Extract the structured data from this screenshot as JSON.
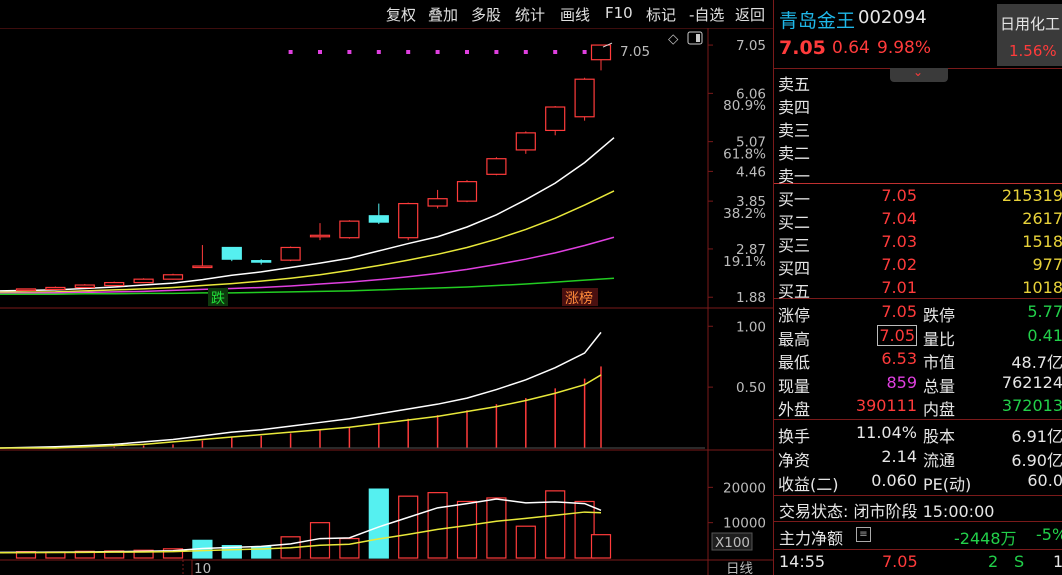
{
  "toolbar": {
    "items": [
      "复权",
      "叠加",
      "多股",
      "统计",
      "画线",
      "F10",
      "标记",
      "-自选",
      "返回"
    ]
  },
  "header": {
    "stock_name": "青岛金王",
    "stock_code": "002094",
    "price": "7.05",
    "change": "0.64",
    "change_pct": "9.98%",
    "sector_name": "日用化工",
    "sector_pct": "1.56%"
  },
  "orderbook": {
    "sell": [
      {
        "label": "卖五",
        "price": "",
        "vol": ""
      },
      {
        "label": "卖四",
        "price": "",
        "vol": ""
      },
      {
        "label": "卖三",
        "price": "",
        "vol": ""
      },
      {
        "label": "卖二",
        "price": "",
        "vol": ""
      },
      {
        "label": "卖一",
        "price": "",
        "vol": ""
      }
    ],
    "buy": [
      {
        "label": "买一",
        "price": "7.05",
        "vol": "215319"
      },
      {
        "label": "买二",
        "price": "7.04",
        "vol": "2617"
      },
      {
        "label": "买三",
        "price": "7.03",
        "vol": "1518"
      },
      {
        "label": "买四",
        "price": "7.02",
        "vol": "977"
      },
      {
        "label": "买五",
        "price": "7.01",
        "vol": "1018"
      }
    ]
  },
  "stats": [
    {
      "l1": "涨停",
      "v1": "7.05",
      "l2": "跌停",
      "v2": "5.77",
      "c1": "red",
      "c2": "green"
    },
    {
      "l1": "最高",
      "v1": "7.05",
      "l2": "量比",
      "v2": "0.41",
      "c1": "red",
      "c2": "green"
    },
    {
      "l1": "最低",
      "v1": "6.53",
      "l2": "市值",
      "v2": "48.7亿",
      "c1": "red",
      "c2": "white"
    },
    {
      "l1": "现量",
      "v1": "859",
      "l2": "总量",
      "v2": "762124",
      "c1": "magenta",
      "c2": "white"
    },
    {
      "l1": "外盘",
      "v1": "390111",
      "l2": "内盘",
      "v2": "372013",
      "c1": "red",
      "c2": "green"
    }
  ],
  "stats2": [
    {
      "l1": "换手",
      "v1": "11.04%",
      "l2": "股本",
      "v2": "6.91亿",
      "c1": "white",
      "c2": "white"
    },
    {
      "l1": "净资",
      "v1": "2.14",
      "l2": "流通",
      "v2": "6.90亿",
      "c1": "white",
      "c2": "white"
    },
    {
      "l1": "收益(二)",
      "v1": "0.060",
      "l2": "PE(动)",
      "v2": "60.0",
      "c1": "white",
      "c2": "white"
    }
  ],
  "trade_status": "交易状态: 闭市阶段 15:00:00",
  "main_flow": {
    "label": "主力净额",
    "value": "-2448万",
    "pct": "-5%"
  },
  "tick": {
    "time": "14:55",
    "price": "7.05",
    "vol": "2",
    "side": "S",
    "extra": "1"
  },
  "chart_labels": {
    "price_marker": "7.05",
    "signal_down": "跌",
    "signal_limit": "涨榜",
    "date_tick": "10",
    "period": "日线",
    "vol_unit": "X100"
  },
  "colors": {
    "up": "#ff3b3b",
    "down": "#55f0f0",
    "ma1": "#ffffff",
    "ma2": "#e8e83a",
    "ma3": "#e040e0",
    "ma4": "#22cc22"
  },
  "chart_data": [
    {
      "type": "candlestick",
      "y_axis_ticks": [
        "7.05",
        "6.06",
        "5.07",
        "4.46",
        "3.85",
        "2.87",
        "1.88"
      ],
      "pct_axis_ticks": [
        "80.9%",
        "61.8%",
        "38.2%",
        "19.1%"
      ],
      "ylim": [
        1.7,
        7.4
      ],
      "candles": [
        {
          "o": 2.03,
          "c": 2.05,
          "h": 2.06,
          "l": 2.02
        },
        {
          "o": 2.04,
          "c": 2.08,
          "h": 2.1,
          "l": 2.03
        },
        {
          "o": 2.08,
          "c": 2.13,
          "h": 2.15,
          "l": 2.07
        },
        {
          "o": 2.12,
          "c": 2.18,
          "h": 2.2,
          "l": 2.11
        },
        {
          "o": 2.18,
          "c": 2.25,
          "h": 2.27,
          "l": 2.17
        },
        {
          "o": 2.25,
          "c": 2.34,
          "h": 2.36,
          "l": 2.24
        },
        {
          "o": 2.52,
          "c": 2.52,
          "h": 2.95,
          "l": 2.5
        },
        {
          "o": 2.9,
          "c": 2.66,
          "h": 2.9,
          "l": 2.62
        },
        {
          "o": 2.63,
          "c": 2.6,
          "h": 2.66,
          "l": 2.55
        },
        {
          "o": 2.64,
          "c": 2.9,
          "h": 2.92,
          "l": 2.62
        },
        {
          "o": 3.15,
          "c": 3.15,
          "h": 3.4,
          "l": 3.05
        },
        {
          "o": 3.1,
          "c": 3.44,
          "h": 3.46,
          "l": 3.08
        },
        {
          "o": 3.55,
          "c": 3.42,
          "h": 3.8,
          "l": 3.38
        },
        {
          "o": 3.1,
          "c": 3.8,
          "h": 3.82,
          "l": 3.05
        },
        {
          "o": 3.75,
          "c": 3.9,
          "h": 4.08,
          "l": 3.7
        },
        {
          "o": 3.85,
          "c": 4.25,
          "h": 4.28,
          "l": 3.83
        },
        {
          "o": 4.4,
          "c": 4.72,
          "h": 4.75,
          "l": 4.38
        },
        {
          "o": 4.9,
          "c": 5.25,
          "h": 5.28,
          "l": 4.82
        },
        {
          "o": 5.3,
          "c": 5.78,
          "h": 5.8,
          "l": 5.2
        },
        {
          "o": 5.58,
          "c": 6.35,
          "h": 6.38,
          "l": 5.5
        },
        {
          "o": 6.75,
          "c": 7.05,
          "h": 7.05,
          "l": 6.53
        }
      ],
      "ma": [
        {
          "name": "MA5",
          "values": [
            2.01,
            2.03,
            2.06,
            2.09,
            2.13,
            2.17,
            2.24,
            2.33,
            2.4,
            2.49,
            2.58,
            2.68,
            2.83,
            2.98,
            3.12,
            3.32,
            3.57,
            3.88,
            4.22,
            4.64,
            5.15
          ]
        },
        {
          "name": "MA10",
          "values": [
            1.98,
            1.99,
            2.01,
            2.03,
            2.05,
            2.08,
            2.12,
            2.16,
            2.21,
            2.27,
            2.34,
            2.43,
            2.53,
            2.64,
            2.76,
            2.9,
            3.07,
            3.27,
            3.5,
            3.77,
            4.06
          ]
        },
        {
          "name": "MA20",
          "values": [
            1.96,
            1.97,
            1.98,
            1.99,
            2.0,
            2.02,
            2.04,
            2.06,
            2.08,
            2.11,
            2.15,
            2.19,
            2.24,
            2.3,
            2.37,
            2.45,
            2.55,
            2.66,
            2.79,
            2.94,
            3.11
          ]
        },
        {
          "name": "MA60",
          "values": [
            1.94,
            1.94,
            1.95,
            1.95,
            1.96,
            1.96,
            1.97,
            1.97,
            1.98,
            1.99,
            2.0,
            2.01,
            2.03,
            2.05,
            2.07,
            2.09,
            2.12,
            2.15,
            2.19,
            2.23,
            2.27
          ]
        }
      ]
    },
    {
      "type": "bar",
      "y_axis_ticks": [
        "1.00",
        "0.50"
      ],
      "ylim": [
        0,
        1.15
      ],
      "values": [
        0.0,
        0.0,
        0.0,
        0.01,
        0.02,
        0.03,
        0.06,
        0.09,
        0.1,
        0.12,
        0.15,
        0.17,
        0.2,
        0.24,
        0.27,
        0.31,
        0.36,
        0.41,
        0.49,
        0.57,
        0.67
      ],
      "series": [
        {
          "name": "line1",
          "values": [
            0.0,
            0.01,
            0.02,
            0.03,
            0.05,
            0.07,
            0.1,
            0.13,
            0.15,
            0.18,
            0.21,
            0.24,
            0.28,
            0.32,
            0.36,
            0.41,
            0.48,
            0.56,
            0.66,
            0.78,
            0.95
          ]
        },
        {
          "name": "line2",
          "values": [
            0.0,
            0.0,
            0.01,
            0.02,
            0.03,
            0.05,
            0.07,
            0.09,
            0.11,
            0.13,
            0.15,
            0.17,
            0.2,
            0.23,
            0.26,
            0.3,
            0.34,
            0.39,
            0.45,
            0.52,
            0.6
          ]
        }
      ]
    },
    {
      "type": "bar",
      "y_axis_ticks": [
        "20000",
        "10000"
      ],
      "unit": "X100",
      "ylim": [
        0,
        30000
      ],
      "values": [
        1800,
        1700,
        1900,
        2000,
        2200,
        2600,
        5000,
        3500,
        3200,
        6000,
        10000,
        5500,
        19500,
        17500,
        18500,
        16000,
        17000,
        9000,
        19000,
        16000,
        6600
      ],
      "up": [
        true,
        true,
        true,
        true,
        true,
        true,
        false,
        false,
        false,
        true,
        true,
        true,
        false,
        true,
        true,
        true,
        true,
        true,
        true,
        true,
        true
      ],
      "series": [
        {
          "name": "MA5",
          "values": [
            1600,
            1650,
            1700,
            1800,
            1900,
            2050,
            2700,
            3000,
            3300,
            4000,
            5500,
            5700,
            8800,
            11500,
            14200,
            15400,
            16700,
            15600,
            15900,
            15400,
            13500
          ]
        },
        {
          "name": "MA10",
          "values": [
            1500,
            1550,
            1600,
            1650,
            1700,
            1800,
            2100,
            2350,
            2550,
            2900,
            3600,
            3900,
            5400,
            6700,
            8100,
            9200,
            10400,
            11200,
            12100,
            13000,
            12800
          ]
        }
      ]
    }
  ]
}
